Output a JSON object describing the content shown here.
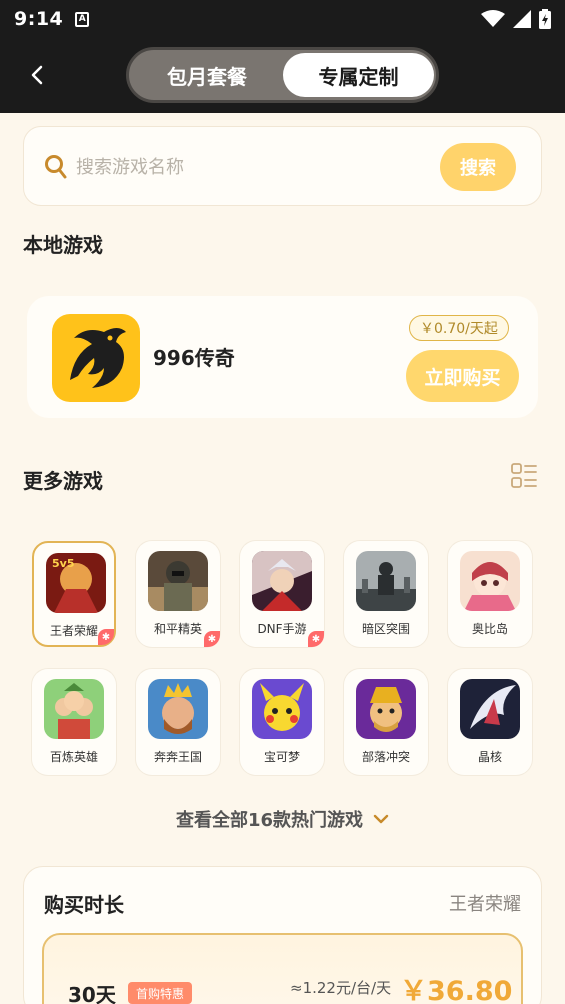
{
  "status_bar": {
    "time": "9:14",
    "notification_icon": "a-icon",
    "icons": [
      "wifi-icon",
      "signal-icon",
      "battery-icon"
    ]
  },
  "header": {
    "back_icon": "chevron-left-icon",
    "tabs": [
      {
        "label": "包月套餐",
        "active": false
      },
      {
        "label": "专属定制",
        "active": true
      }
    ]
  },
  "search": {
    "placeholder": "搜索游戏名称",
    "value": "",
    "button_label": "搜索"
  },
  "local_games": {
    "title": "本地游戏",
    "game": {
      "name": "996传奇",
      "price_tag": "￥0.70/天起",
      "buy_label": "立即购买"
    }
  },
  "more_games": {
    "title": "更多游戏",
    "games": [
      {
        "name": "王者荣耀",
        "selected": true
      },
      {
        "name": "和平精英",
        "selected": false
      },
      {
        "name": "DNF手游",
        "selected": false
      },
      {
        "name": "暗区突围",
        "selected": false
      },
      {
        "name": "奥比岛",
        "selected": false
      },
      {
        "name": "百炼英雄",
        "selected": false
      },
      {
        "name": "奔奔王国",
        "selected": false
      },
      {
        "name": "宝可梦",
        "selected": false
      },
      {
        "name": "部落冲突",
        "selected": false
      },
      {
        "name": "晶核",
        "selected": false
      }
    ],
    "view_all": "查看全部16款热门游戏"
  },
  "purchase": {
    "title": "购买时长",
    "selected_game": "王者荣耀",
    "plan": {
      "days": "30天",
      "badge": "首购特惠",
      "per_day": "≈1.22元/台/天",
      "price": "￥36.80"
    }
  },
  "colors": {
    "accent": "#ffd36b",
    "price": "#f0a938",
    "background": "#fdf7ec",
    "header": "#1b1b1b"
  }
}
